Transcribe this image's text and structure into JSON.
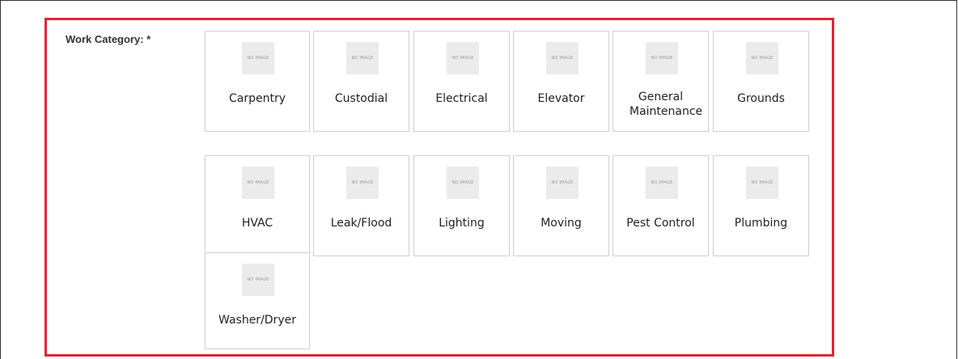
{
  "form": {
    "label": "Work Category: *"
  },
  "thumb_text": "NO IMAGE",
  "tiles": [
    {
      "label": "Carpentry"
    },
    {
      "label": "Custodial"
    },
    {
      "label": "Electrical"
    },
    {
      "label": "Elevator"
    },
    {
      "label": "General Maintenance"
    },
    {
      "label": "Grounds"
    },
    {
      "label": "HVAC"
    },
    {
      "label": "Leak/Flood"
    },
    {
      "label": "Lighting"
    },
    {
      "label": "Moving"
    },
    {
      "label": "Pest Control"
    },
    {
      "label": "Plumbing"
    },
    {
      "label": "Washer/Dryer"
    }
  ],
  "colors": {
    "highlight": "#e32432",
    "tile_border": "#cfcfcf"
  }
}
